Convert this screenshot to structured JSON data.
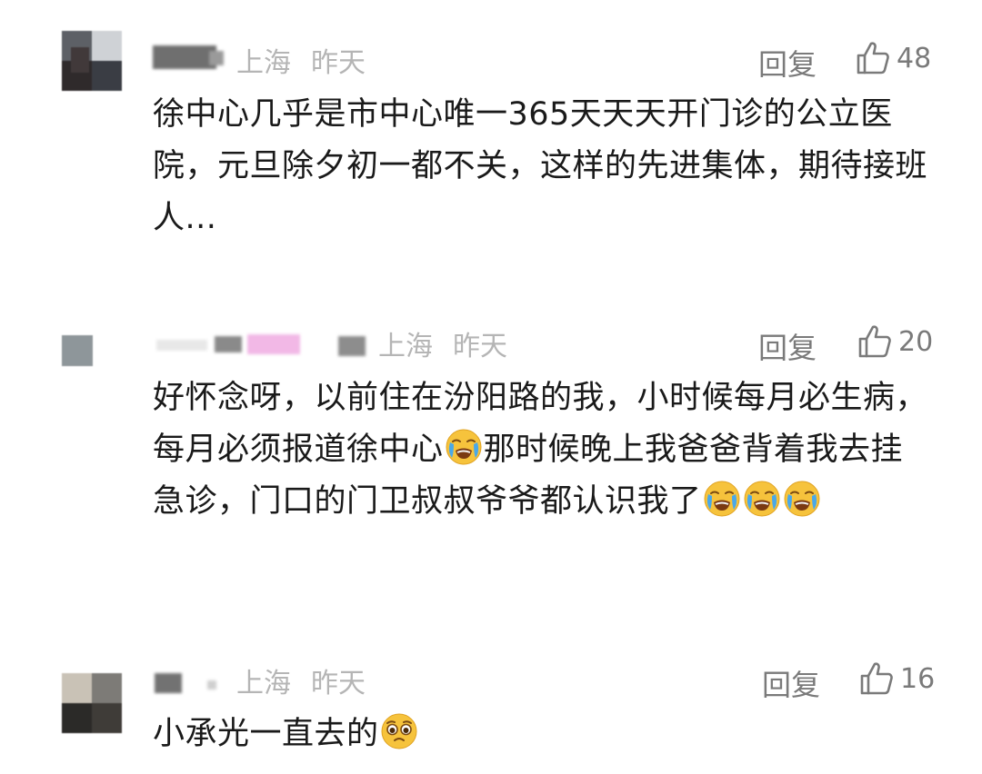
{
  "comments": [
    {
      "location": "上海",
      "time": "昨天",
      "reply_label": "回复",
      "likes": "48",
      "text": "徐中心几乎是市中心唯一365天天天开门诊的公立医院，元旦除夕初一都不关，这样的先进集体，期待接班人..."
    },
    {
      "location": "上海",
      "time": "昨天",
      "reply_label": "回复",
      "likes": "20",
      "text_1": "好怀念呀，以前住在汾阳路的我，小时候每月必生病，每月必须报道徐中心",
      "text_2": "那时候晚上我爸爸背着我去挂急诊，门口的门卫叔叔爷爷都认识我了"
    },
    {
      "location": "上海",
      "time": "昨天",
      "reply_label": "回复",
      "likes": "16",
      "text": "小承光一直去的"
    }
  ],
  "icons": {
    "like": "thumbs-up-outline-icon",
    "crying_emoji": "loudly-crying-face-icon",
    "pleading_emoji": "pleading-face-icon"
  },
  "colors": {
    "text": "#1a1a1a",
    "meta": "#b5b5b5",
    "action": "#7a7a7a",
    "emoji_face": "#f6c33c",
    "emoji_tear": "#4aa8e8"
  }
}
